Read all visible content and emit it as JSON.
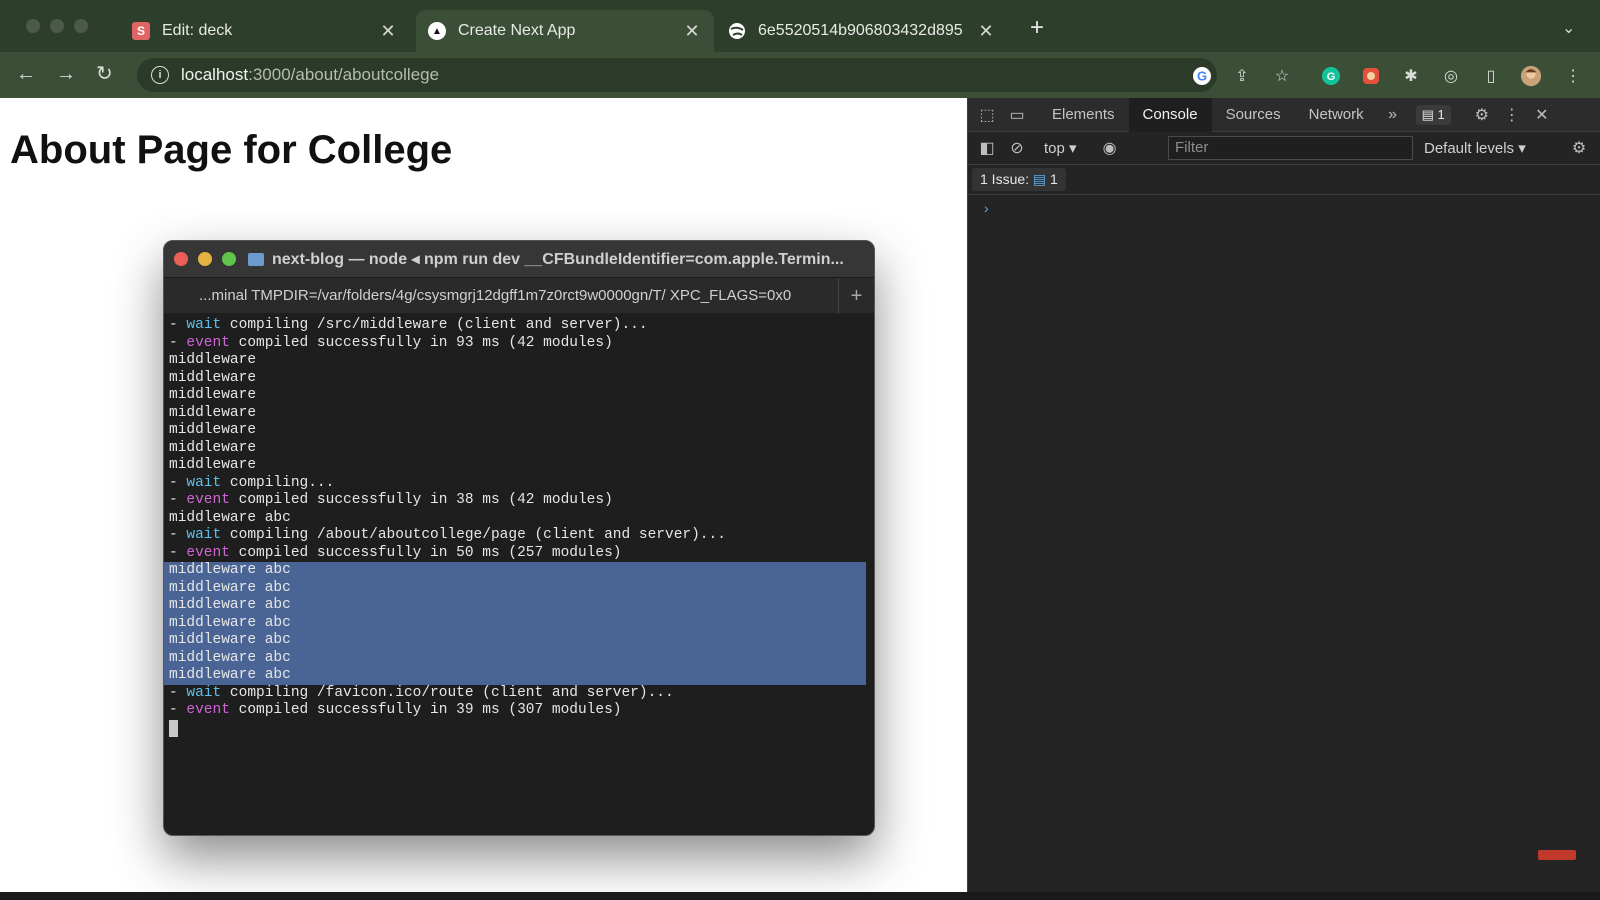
{
  "browser": {
    "tabs": [
      {
        "title": "Edit: deck",
        "favicon": "S",
        "favicon_color": "#e16464",
        "active": false
      },
      {
        "title": "Create Next App",
        "favicon": "▲",
        "favicon_color": "#ffffff",
        "active": true
      },
      {
        "title": "6e5520514b906803432d895",
        "favicon": "globe-icon",
        "favicon_color": "#ffffff",
        "active": false
      }
    ],
    "new_tab_label": "+",
    "url_host": "localhost",
    "url_path": ":3000/about/aboutcollege"
  },
  "page": {
    "heading": "About Page for College"
  },
  "terminal": {
    "title": "next-blog — node ◂ npm run dev __CFBundleIdentifier=com.apple.Termin...",
    "tab_label": "...minal TMPDIR=/var/folders/4g/csysmgrj12dgff1m7z0rct9w0000gn/T/ XPC_FLAGS=0x0",
    "plus_label": "+",
    "lines": [
      {
        "prefix": "- ",
        "kw": "wait",
        "kind": "wait",
        "text": " compiling /src/middleware (client and server)..."
      },
      {
        "prefix": "- ",
        "kw": "event",
        "kind": "event",
        "text": " compiled successfully in 93 ms (42 modules)"
      },
      {
        "prefix": "",
        "kw": "",
        "kind": "plain",
        "text": "middleware"
      },
      {
        "prefix": "",
        "kw": "",
        "kind": "plain",
        "text": "middleware"
      },
      {
        "prefix": "",
        "kw": "",
        "kind": "plain",
        "text": "middleware"
      },
      {
        "prefix": "",
        "kw": "",
        "kind": "plain",
        "text": "middleware"
      },
      {
        "prefix": "",
        "kw": "",
        "kind": "plain",
        "text": "middleware"
      },
      {
        "prefix": "",
        "kw": "",
        "kind": "plain",
        "text": "middleware"
      },
      {
        "prefix": "",
        "kw": "",
        "kind": "plain",
        "text": "middleware"
      },
      {
        "prefix": "- ",
        "kw": "wait",
        "kind": "wait",
        "text": " compiling..."
      },
      {
        "prefix": "- ",
        "kw": "event",
        "kind": "event",
        "text": " compiled successfully in 38 ms (42 modules)"
      },
      {
        "prefix": "",
        "kw": "",
        "kind": "plain",
        "text": "middleware abc"
      },
      {
        "prefix": "- ",
        "kw": "wait",
        "kind": "wait",
        "text": " compiling /about/aboutcollege/page (client and server)..."
      },
      {
        "prefix": "- ",
        "kw": "event",
        "kind": "event",
        "text": " compiled successfully in 50 ms (257 modules)"
      },
      {
        "prefix": "",
        "kw": "",
        "kind": "plain",
        "text": "middleware abc"
      },
      {
        "prefix": "",
        "kw": "",
        "kind": "plain",
        "text": "middleware abc"
      },
      {
        "prefix": "",
        "kw": "",
        "kind": "plain",
        "text": "middleware abc"
      },
      {
        "prefix": "",
        "kw": "",
        "kind": "plain",
        "text": "middleware abc"
      },
      {
        "prefix": "",
        "kw": "",
        "kind": "plain",
        "text": "middleware abc"
      },
      {
        "prefix": "",
        "kw": "",
        "kind": "plain",
        "text": "middleware abc"
      },
      {
        "prefix": "",
        "kw": "",
        "kind": "plain",
        "text": "middleware abc"
      },
      {
        "prefix": "- ",
        "kw": "wait",
        "kind": "wait",
        "text": " compiling /favicon.ico/route (client and server)..."
      },
      {
        "prefix": "- ",
        "kw": "event",
        "kind": "event",
        "text": " compiled successfully in 39 ms (307 modules)"
      }
    ],
    "selected_line_range": [
      14,
      20
    ],
    "colors": {
      "wait": "#5bc0e8",
      "event": "#d066d6",
      "selection": "#4a6595"
    }
  },
  "devtools": {
    "tabs": [
      "Elements",
      "Console",
      "Sources",
      "Network"
    ],
    "active_tab": "Console",
    "badge_count": "1",
    "context": "top",
    "filter_placeholder": "Filter",
    "levels": "Default levels",
    "issues_label": "1 Issue:",
    "issues_count": "1"
  }
}
